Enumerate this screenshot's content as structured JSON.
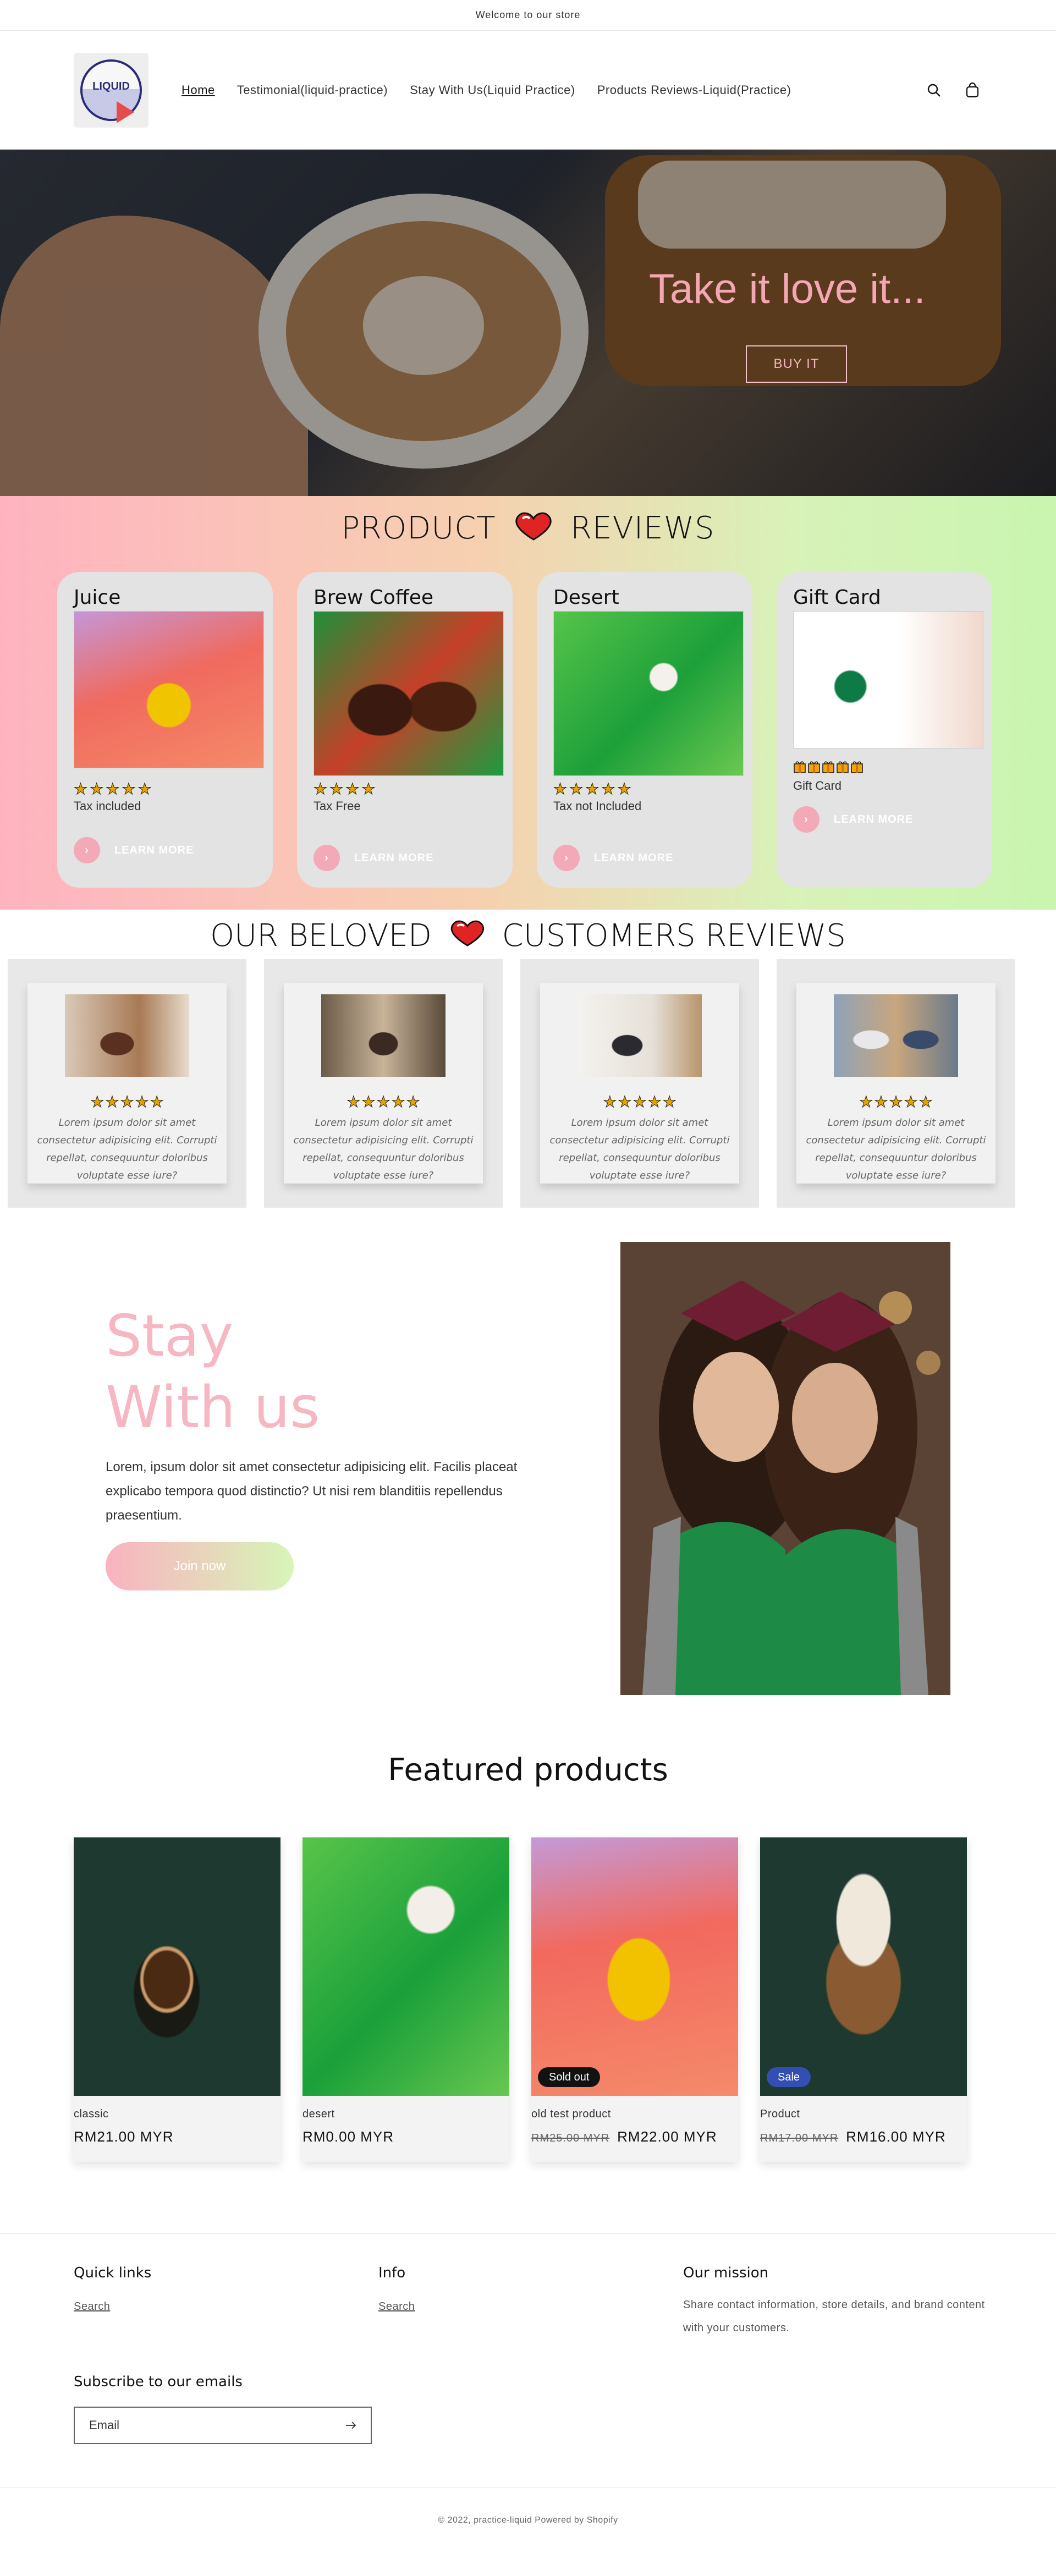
{
  "announcement": "Welcome to our store",
  "header": {
    "logo_text": "LIQUID",
    "nav": [
      "Home",
      "Testimonial(liquid-practice)",
      "Stay With Us(Liquid Practice)",
      "Products Reviews-Liquid(Practice)"
    ],
    "icons": [
      "search-icon",
      "cart-icon"
    ]
  },
  "hero": {
    "title": "Take it love it...",
    "button": "BUY IT"
  },
  "product_reviews": {
    "title_left": "PRODUCT",
    "title_right": "REVIEWS",
    "cards": [
      {
        "name": "Juice",
        "subtitle": "Tax included",
        "cta": "LEARN MORE",
        "rating": 5,
        "icon": "star-icon"
      },
      {
        "name": "Brew Coffee",
        "subtitle": "Tax Free",
        "cta": "LEARN MORE",
        "rating": 4,
        "icon": "star-icon"
      },
      {
        "name": "Desert",
        "subtitle": "Tax not Included",
        "cta": "LEARN MORE",
        "rating": 5,
        "icon": "star-icon"
      },
      {
        "name": "Gift Card",
        "subtitle": "Gift Card",
        "cta": "LEARN MORE",
        "rating": 5,
        "icon": "gift-icon"
      }
    ]
  },
  "customer_reviews": {
    "title_left": "OUR BELOVED",
    "title_right": "CUSTOMERS REVIEWS",
    "cards": [
      {
        "text": "Lorem ipsum dolor sit amet consectetur adipisicing elit. Corrupti repellat, consequuntur doloribus voluptate esse iure?",
        "rating": 5
      },
      {
        "text": "Lorem ipsum dolor sit amet consectetur adipisicing elit. Corrupti repellat, consequuntur doloribus voluptate esse iure?",
        "rating": 5
      },
      {
        "text": "Lorem ipsum dolor sit amet consectetur adipisicing elit. Corrupti repellat, consequuntur doloribus voluptate esse iure?",
        "rating": 5
      },
      {
        "text": "Lorem ipsum dolor sit amet consectetur adipisicing elit. Corrupti repellat, consequuntur doloribus voluptate esse iure?",
        "rating": 5
      }
    ]
  },
  "stay": {
    "line1": "Stay",
    "line2": "With us",
    "body": "Lorem, ipsum dolor sit amet consectetur adipisicing elit. Facilis placeat explicabo tempora quod distinctio? Ut nisi rem blanditiis repellendus praesentium.",
    "button": "Join now"
  },
  "featured": {
    "title": "Featured products",
    "products": [
      {
        "name": "classic",
        "price": "RM21.00 MYR",
        "compare": "",
        "badge": ""
      },
      {
        "name": "desert",
        "price": "RM0.00 MYR",
        "compare": "",
        "badge": ""
      },
      {
        "name": "old test product",
        "price": "RM22.00 MYR",
        "compare": "RM25.00 MYR",
        "badge": "Sold out"
      },
      {
        "name": "Product",
        "price": "RM16.00 MYR",
        "compare": "RM17.00 MYR",
        "badge": "Sale"
      }
    ]
  },
  "footer": {
    "quick_links_title": "Quick links",
    "quick_links": [
      "Search"
    ],
    "info_title": "Info",
    "info_links": [
      "Search"
    ],
    "mission_title": "Our mission",
    "mission_text": "Share contact information, store details, and brand content with your customers.",
    "subscribe_title": "Subscribe to our emails",
    "email_placeholder": "Email",
    "copyright": "© 2022, practice-liquid Powered by Shopify"
  },
  "colors": {
    "accent_pink": "#f6b6c2",
    "accent_green": "#d7f5b7",
    "sold_out": "#121212",
    "sale": "#334fb4"
  }
}
